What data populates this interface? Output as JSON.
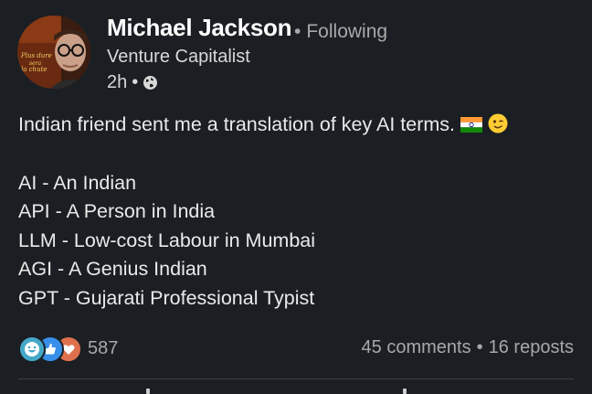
{
  "author": {
    "name": "Michael Jackson",
    "follow_status": "Following",
    "headline": "Venture Capitalist",
    "time": "2h",
    "avatar_sign_text": [
      "Plus dure",
      "sera",
      "la chute"
    ]
  },
  "post": {
    "intro": "Indian friend sent me a translation of key AI terms.",
    "lines": [
      "AI - An Indian",
      "API - A Person in India",
      "LLM - Low-cost Labour in Mumbai",
      "AGI - A Genius Indian",
      "GPT - Gujarati Professional Typist"
    ],
    "emoji": [
      "indian-flag-icon",
      "winking-face-icon"
    ]
  },
  "engagement": {
    "reactions_count": "587",
    "reaction_icons": [
      "funny-reaction-icon",
      "like-reaction-icon",
      "love-reaction-icon"
    ],
    "comments": "45 comments",
    "reposts": "16 reposts"
  },
  "colors": {
    "background": "#1b1f23",
    "primary_text": "#ffffff",
    "secondary_text": "#a8a8a8",
    "divider": "#3b3f44"
  }
}
